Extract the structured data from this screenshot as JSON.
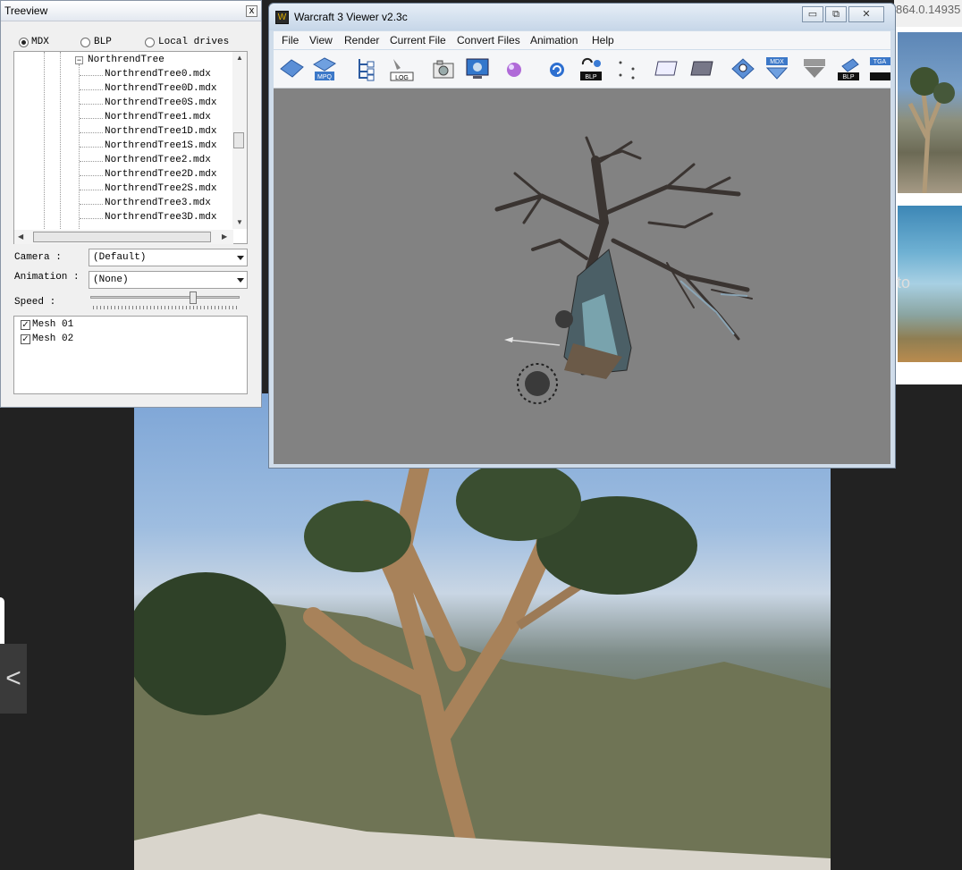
{
  "background": {
    "url_fragment": "864.0.14935",
    "thumb_text": "to",
    "prev_nav_label": "<"
  },
  "treeview": {
    "title": "Treeview",
    "close_label": "x",
    "radios": [
      {
        "label": "MDX",
        "checked": true
      },
      {
        "label": "BLP",
        "checked": false
      },
      {
        "label": "Local drives",
        "checked": false
      }
    ],
    "folder": "NorthrendTree",
    "expander": "−",
    "files": [
      "NorthrendTree0.mdx",
      "NorthrendTree0D.mdx",
      "NorthrendTree0S.mdx",
      "NorthrendTree1.mdx",
      "NorthrendTree1D.mdx",
      "NorthrendTree1S.mdx",
      "NorthrendTree2.mdx",
      "NorthrendTree2D.mdx",
      "NorthrendTree2S.mdx",
      "NorthrendTree3.mdx",
      "NorthrendTree3D.mdx"
    ],
    "camera_label": "Camera :",
    "camera_value": "(Default)",
    "animation_label": "Animation :",
    "animation_value": "(None)",
    "speed_label": "Speed :",
    "speed_fraction": 0.7,
    "meshes": [
      {
        "label": "Mesh 01",
        "checked": true
      },
      {
        "label": "Mesh 02",
        "checked": true
      }
    ]
  },
  "viewer": {
    "title": "Warcraft 3 Viewer v2.3c",
    "app_icon_glyph": "W",
    "caption_buttons": [
      "▭",
      "⧉",
      "✕"
    ],
    "menu": [
      "File",
      "View",
      "Render",
      "Current File",
      "Convert Files",
      "Animation",
      "Help"
    ],
    "toolbar_icons": [
      "open-diamond-icon",
      "mpq-icon",
      "tree-structure-icon",
      "log-icon",
      "camera-snapshot-icon",
      "monitor-icon",
      "sphere-icon",
      "refresh-icon",
      "blp-convert-icon",
      "dots-icon",
      "panel-icon",
      "panel-dark-icon",
      "search-tool-icon",
      "mdx-save-icon",
      "arrow-gray-icon",
      "blp-export-icon",
      "tga-icon"
    ],
    "toolbar_text": {
      "mpq": "MPQ",
      "log": "LOG",
      "blp": "BLP",
      "mdx": "MDX",
      "tga": "TGA"
    }
  },
  "colors": {
    "viewport_bg": "#828282",
    "window_frame": "#cfdcea",
    "desktop": "#222222"
  }
}
